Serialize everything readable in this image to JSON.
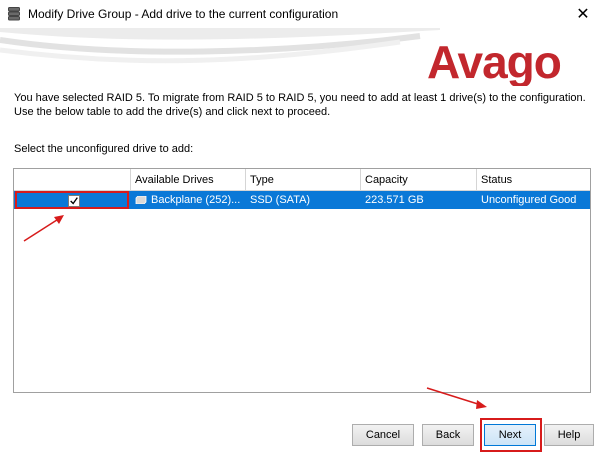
{
  "window": {
    "title": "Modify Drive Group - Add drive to the current configuration",
    "close_glyph": "✕"
  },
  "brand": {
    "logo_text": "Avago",
    "logo_color": "#c2272d"
  },
  "intro": {
    "line1": "You have selected RAID 5. To migrate from RAID 5 to RAID 5, you need to add at least 1 drive(s) to the configuration.",
    "line2": "Use the below table to add the drive(s) and click next to proceed."
  },
  "select_label": "Select the unconfigured drive to add:",
  "table": {
    "columns": [
      "",
      "Available Drives",
      "Type",
      "Capacity",
      "Status"
    ],
    "rows": [
      {
        "selected": true,
        "checked": true,
        "available_drive": "Backplane (252)...",
        "type": "SSD  (SATA)",
        "capacity": "223.571 GB",
        "status": "Unconfigured Good"
      }
    ],
    "selection_color": "#0a78d7"
  },
  "buttons": {
    "cancel": "Cancel",
    "back": "Back",
    "next": "Next",
    "help": "Help"
  },
  "annotation_color": "#d71b1b"
}
